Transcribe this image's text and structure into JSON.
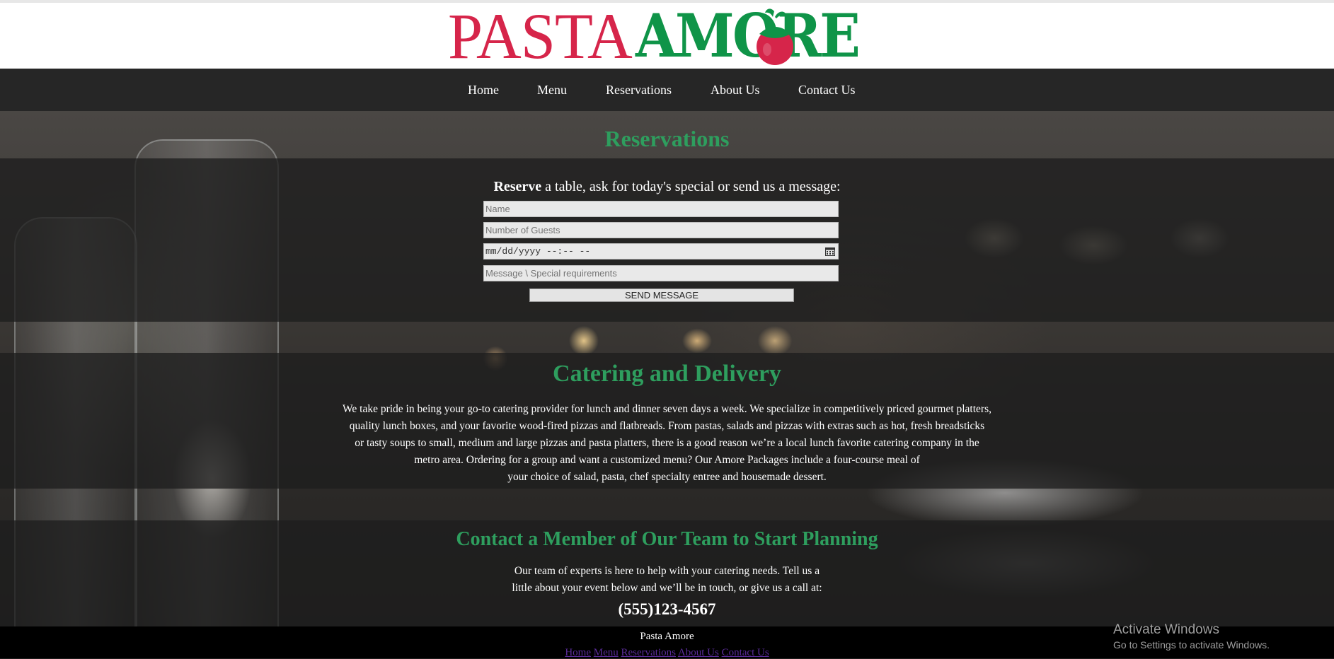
{
  "brand": {
    "logo_pasta": "PASTA",
    "logo_amore": "AMORE",
    "colors": {
      "pasta": "#d6254a",
      "amore": "#0f9448",
      "heading_green": "#2e9e5e"
    }
  },
  "nav": {
    "items": [
      "Home",
      "Menu",
      "Reservations",
      "About Us",
      "Contact Us"
    ]
  },
  "reservations": {
    "title": "Reservations",
    "intro_bold": "Reserve",
    "intro_rest": " a table, ask for today's special or send us a message:",
    "form": {
      "name_placeholder": "Name",
      "guests_placeholder": "Number of Guests",
      "datetime_value": "mm/dd/yyyy --:-- --",
      "message_placeholder": "Message \\ Special requirements",
      "submit_label": "SEND MESSAGE"
    }
  },
  "catering": {
    "title": "Catering and Delivery",
    "lines": [
      "We take pride in being your go-to catering provider for lunch and dinner seven days a week. We specialize in competitively priced gourmet platters,",
      "quality lunch boxes, and your favorite wood-fired pizzas and flatbreads. From pastas, salads and pizzas with extras such as hot, fresh breadsticks",
      "or tasty soups to small, medium and large pizzas and pasta platters, there is a good reason we’re a local lunch favorite catering company in the",
      "metro area. Ordering for a group and want a customized menu? Our Amore Packages include a four-course meal of",
      "your choice of salad, pasta, chef specialty entree and housemade dessert."
    ]
  },
  "contact": {
    "title": "Contact a Member of Our Team to Start Planning",
    "lines": [
      "Our team of experts is here to help with your catering needs. Tell us a",
      "little about your event below and we’ll be in touch, or give us a call at:"
    ],
    "phone": "(555)123-4567"
  },
  "footer": {
    "title": "Pasta Amore",
    "links": [
      "Home",
      "Menu",
      "Reservations",
      "About Us",
      "Contact Us"
    ]
  },
  "watermark": {
    "title": "Activate Windows",
    "subtitle": "Go to Settings to activate Windows."
  }
}
